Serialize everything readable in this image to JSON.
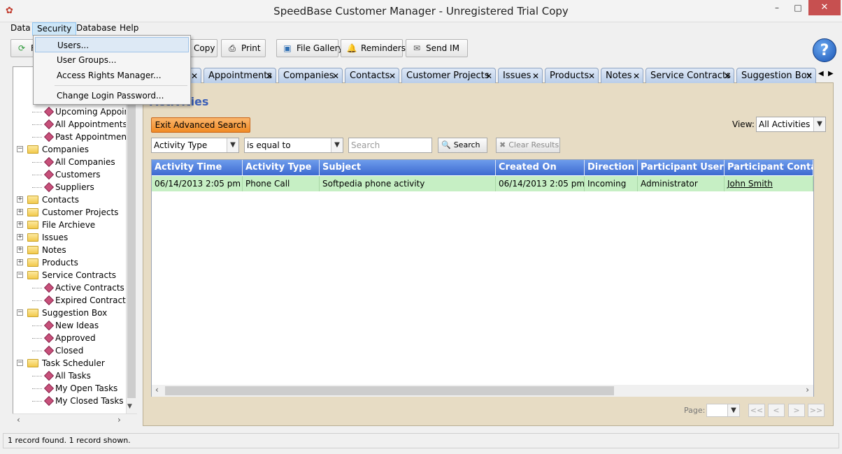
{
  "window": {
    "title": "SpeedBase Customer Manager - Unregistered Trial Copy",
    "controls": {
      "minimize": "–",
      "maximize": "□",
      "close": "✕"
    }
  },
  "menubar": [
    "Data",
    "Security",
    "Database",
    "Help"
  ],
  "security_menu": {
    "items": [
      "Users...",
      "User Groups...",
      "Access Rights Manager...",
      "Change Login Password..."
    ]
  },
  "toolbar": {
    "partial_label": "F",
    "copy": "Copy",
    "print": "Print",
    "file_gallery": "File Gallery",
    "reminders": "Reminders",
    "send_im": "Send IM",
    "help": "?"
  },
  "tree": [
    {
      "label": "Upcoming Appoint",
      "type": "leaf"
    },
    {
      "label": "All Appointments",
      "type": "leaf"
    },
    {
      "label": "Past Appointments",
      "type": "leaf"
    },
    {
      "label": "Companies",
      "type": "folder",
      "expanded": true
    },
    {
      "label": "All Companies",
      "type": "leaf"
    },
    {
      "label": "Customers",
      "type": "leaf"
    },
    {
      "label": "Suppliers",
      "type": "leaf"
    },
    {
      "label": "Contacts",
      "type": "folder",
      "expanded": false
    },
    {
      "label": "Customer Projects",
      "type": "folder",
      "expanded": false
    },
    {
      "label": "File Archieve",
      "type": "folder",
      "expanded": false
    },
    {
      "label": "Issues",
      "type": "folder",
      "expanded": false
    },
    {
      "label": "Notes",
      "type": "folder",
      "expanded": false
    },
    {
      "label": "Products",
      "type": "folder",
      "expanded": false
    },
    {
      "label": "Service Contracts",
      "type": "folder",
      "expanded": true
    },
    {
      "label": "Active Contracts",
      "type": "leaf"
    },
    {
      "label": "Expired Contracts",
      "type": "leaf"
    },
    {
      "label": "Suggestion Box",
      "type": "folder",
      "expanded": true
    },
    {
      "label": "New Ideas",
      "type": "leaf"
    },
    {
      "label": "Approved",
      "type": "leaf"
    },
    {
      "label": "Closed",
      "type": "leaf"
    },
    {
      "label": "Task Scheduler",
      "type": "folder",
      "expanded": true
    },
    {
      "label": "All Tasks",
      "type": "leaf"
    },
    {
      "label": "My Open Tasks",
      "type": "leaf"
    },
    {
      "label": "My Closed Tasks",
      "type": "leaf"
    }
  ],
  "tabs": [
    "Appointments",
    "Companies",
    "Contacts",
    "Customer Projects",
    "Issues",
    "Products",
    "Notes",
    "Service Contracts",
    "Suggestion Box"
  ],
  "page": {
    "heading": "Activities",
    "exit_advanced_search": "Exit Advanced Search",
    "view_label": "View:",
    "view_value": "All Activities",
    "filter_field": "Activity Type",
    "filter_operator": "is equal to",
    "search_placeholder": "Search",
    "search_button": "Search",
    "clear_button": "Clear Results"
  },
  "grid": {
    "columns": [
      "Activity Time",
      "Activity Type",
      "Subject",
      "Created On",
      "Direction",
      "Participant User",
      "Participant Contact"
    ],
    "rows": [
      [
        "06/14/2013    2:05 pm",
        "Phone Call",
        "Softpedia phone activity",
        "06/14/2013    2:05 pm",
        "Incoming",
        "Administrator",
        "John Smith"
      ]
    ]
  },
  "pager": {
    "label": "Page:",
    "buttons": [
      "<<",
      "<",
      ">",
      ">>"
    ]
  },
  "status": "1 record found. 1 record shown."
}
